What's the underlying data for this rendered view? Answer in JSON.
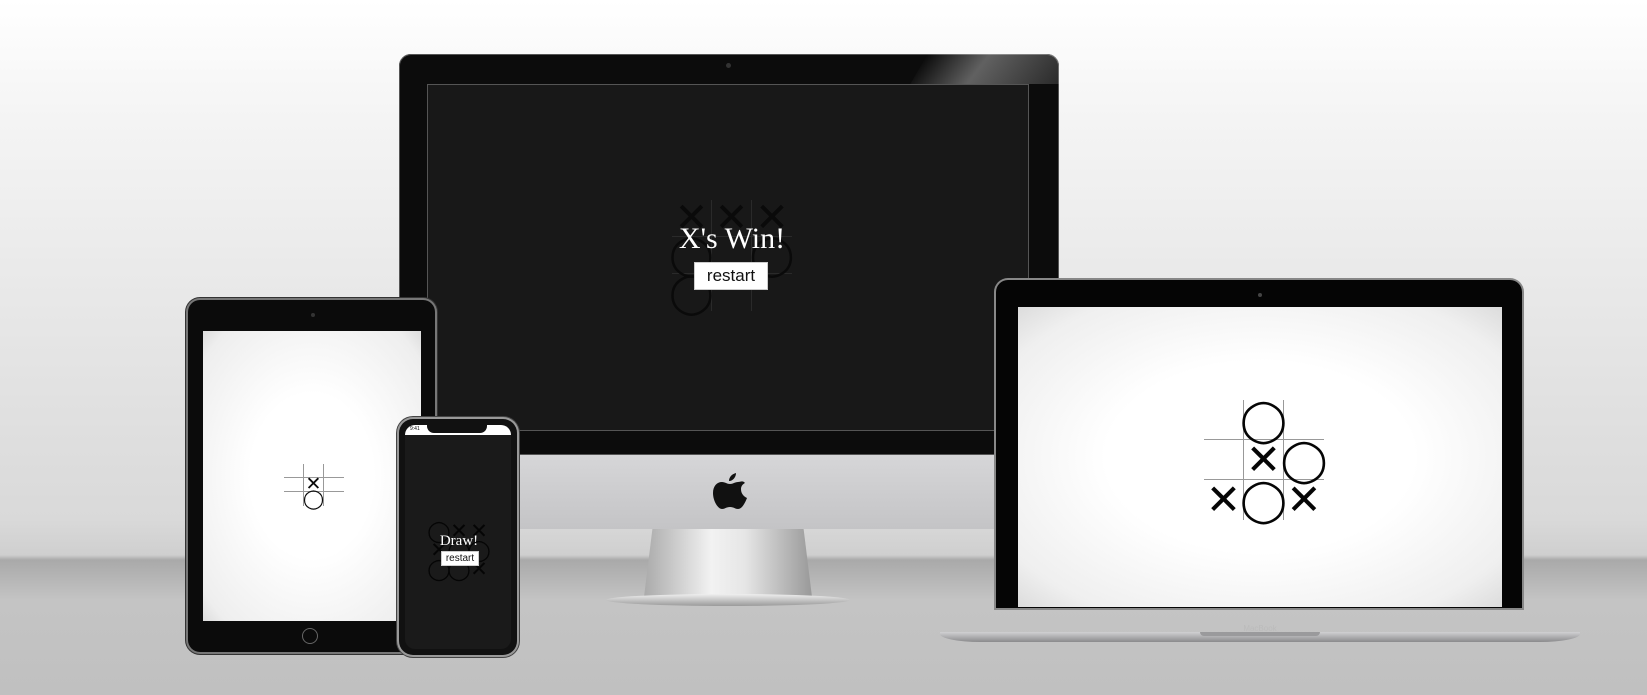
{
  "imac": {
    "message": "X's Win!",
    "restart_label": "restart",
    "board": [
      "✕",
      "✕",
      "✕",
      "◯",
      "",
      "◯",
      "◯",
      "",
      ""
    ]
  },
  "ipad": {
    "board": [
      "",
      "",
      "",
      "",
      "✕",
      "",
      "",
      "◯",
      ""
    ]
  },
  "iphone": {
    "status_time": "9:41",
    "message": "Draw!",
    "restart_label": "restart",
    "board": [
      "◯",
      "✕",
      "✕",
      "✕",
      "◯",
      "◯",
      "◯",
      "◯",
      "✕"
    ]
  },
  "macbook": {
    "brand_label": "MacBook",
    "board": [
      "",
      "◯",
      "",
      "",
      "✕",
      "◯",
      "✕",
      "◯",
      "✕"
    ]
  },
  "icons": {
    "apple": "apple-logo-icon"
  }
}
